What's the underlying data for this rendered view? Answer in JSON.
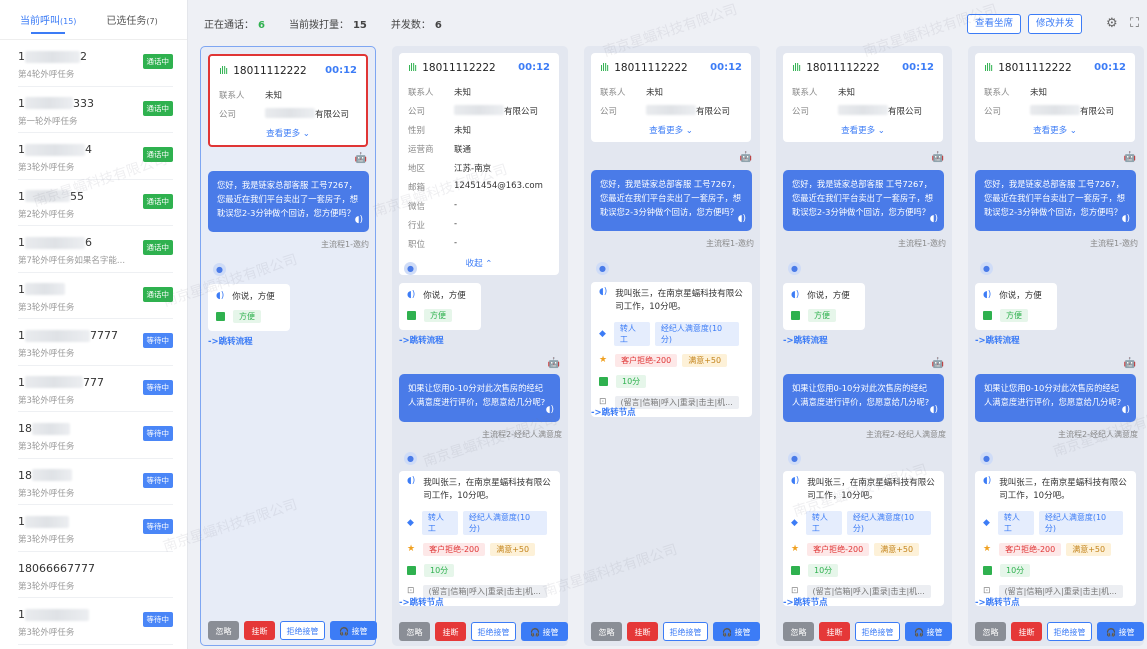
{
  "tabs": {
    "current": "当前呼叫",
    "current_count": "(15)",
    "selected": "已选任务",
    "selected_count": "(7)"
  },
  "stats": {
    "talking_label": "正在通话：",
    "talking": "6",
    "dialing_label": "当前拨打量：",
    "dialing": "15",
    "concurrency_label": "并发数：",
    "concurrency": "6"
  },
  "top_buttons": {
    "view_agents": "查看坐席",
    "modify_concurrency": "修改并发"
  },
  "left_list": [
    {
      "phone_tail": "2",
      "task": "第4轮外呼任务",
      "status": "通话中",
      "kind": "green"
    },
    {
      "phone_tail": "333",
      "task": "第一轮外呼任务",
      "status": "通话中",
      "kind": "green"
    },
    {
      "phone_tail": "4",
      "task": "第3轮外呼任务",
      "status": "通话中",
      "kind": "green"
    },
    {
      "phone_tail": "55",
      "task": "第2轮外呼任务",
      "status": "通话中",
      "kind": "green"
    },
    {
      "phone_tail": "6",
      "task": "第7轮外呼任务如果名字能...",
      "status": "通话中",
      "kind": "green"
    },
    {
      "phone_tail": "",
      "task": "第3轮外呼任务",
      "status": "通话中",
      "kind": "green"
    },
    {
      "phone_tail": "7777",
      "task": "第3轮外呼任务",
      "status": "等待中",
      "kind": "blue"
    },
    {
      "phone_tail": "777",
      "task": "第3轮外呼任务",
      "status": "等待中",
      "kind": "blue"
    },
    {
      "phone_tail": "",
      "task": "第3轮外呼任务",
      "status": "等待中",
      "kind": "blue"
    },
    {
      "phone_tail": "",
      "task": "第3轮外呼任务",
      "status": "等待中",
      "kind": "blue"
    },
    {
      "phone_tail": "",
      "task": "第3轮外呼任务",
      "status": "等待中",
      "kind": "blue"
    },
    {
      "phone_tail": "",
      "task": "第3轮外呼任务",
      "status": "",
      "kind": "none"
    },
    {
      "phone_tail": "",
      "task": "第3轮外呼任务",
      "status": "等待中",
      "kind": "blue"
    }
  ],
  "left_phone_prefixes": [
    "1",
    "1",
    "1",
    "1",
    "1",
    "1",
    "1",
    "1",
    "18",
    "18",
    "1",
    "18066667777",
    "1"
  ],
  "call": {
    "phone": "18011112222",
    "time": "00:12",
    "contact_label": "联系人",
    "contact": "未知",
    "company_label": "公司",
    "company_suffix": "有限公司",
    "more": "查看更多 ⌄",
    "collapse": "收起 ⌃"
  },
  "details": [
    {
      "k": "性别",
      "v": "未知"
    },
    {
      "k": "运营商",
      "v": "联通"
    },
    {
      "k": "地区",
      "v": "江苏-南京"
    },
    {
      "k": "邮箱",
      "v": "12451454@163.com"
    },
    {
      "k": "微信",
      "v": "-"
    },
    {
      "k": "行业",
      "v": "-"
    },
    {
      "k": "职位",
      "v": "-"
    }
  ],
  "robot_msg1": "您好，我是链家总部客服 工号7267，您最近在我们平台卖出了一套房子，想耽误您2-3分钟做个回访，您方便吗？",
  "cap1": "主流程1-邀约",
  "reply1": "你说，方便",
  "tag_fangbian": "方便",
  "jump_flow": "->跳转流程",
  "robot_msg2": "如果让您用0-10分对此次售房的经纪人满意度进行评价，您愿意给几分呢?",
  "cap2": "主流程2-经纪人满意度",
  "reply2": "我叫张三，在南京星蝠科技有限公司工作，10分吧。",
  "tags": {
    "transfer": "转人工",
    "satisfaction": "经纪人满意度(10分)",
    "refuse": "客户拒绝-200",
    "satisfied": "满意+50",
    "ten": "10分",
    "intent": "(留言|信箱|呼入|重录|击主|机..."
  },
  "jump_node": "->跳转节点",
  "actions": {
    "ignore": "忽略",
    "hangup": "挂断",
    "reject": "拒绝接管",
    "take": "接管"
  },
  "watermark": "南京星蝠科技有限公司"
}
